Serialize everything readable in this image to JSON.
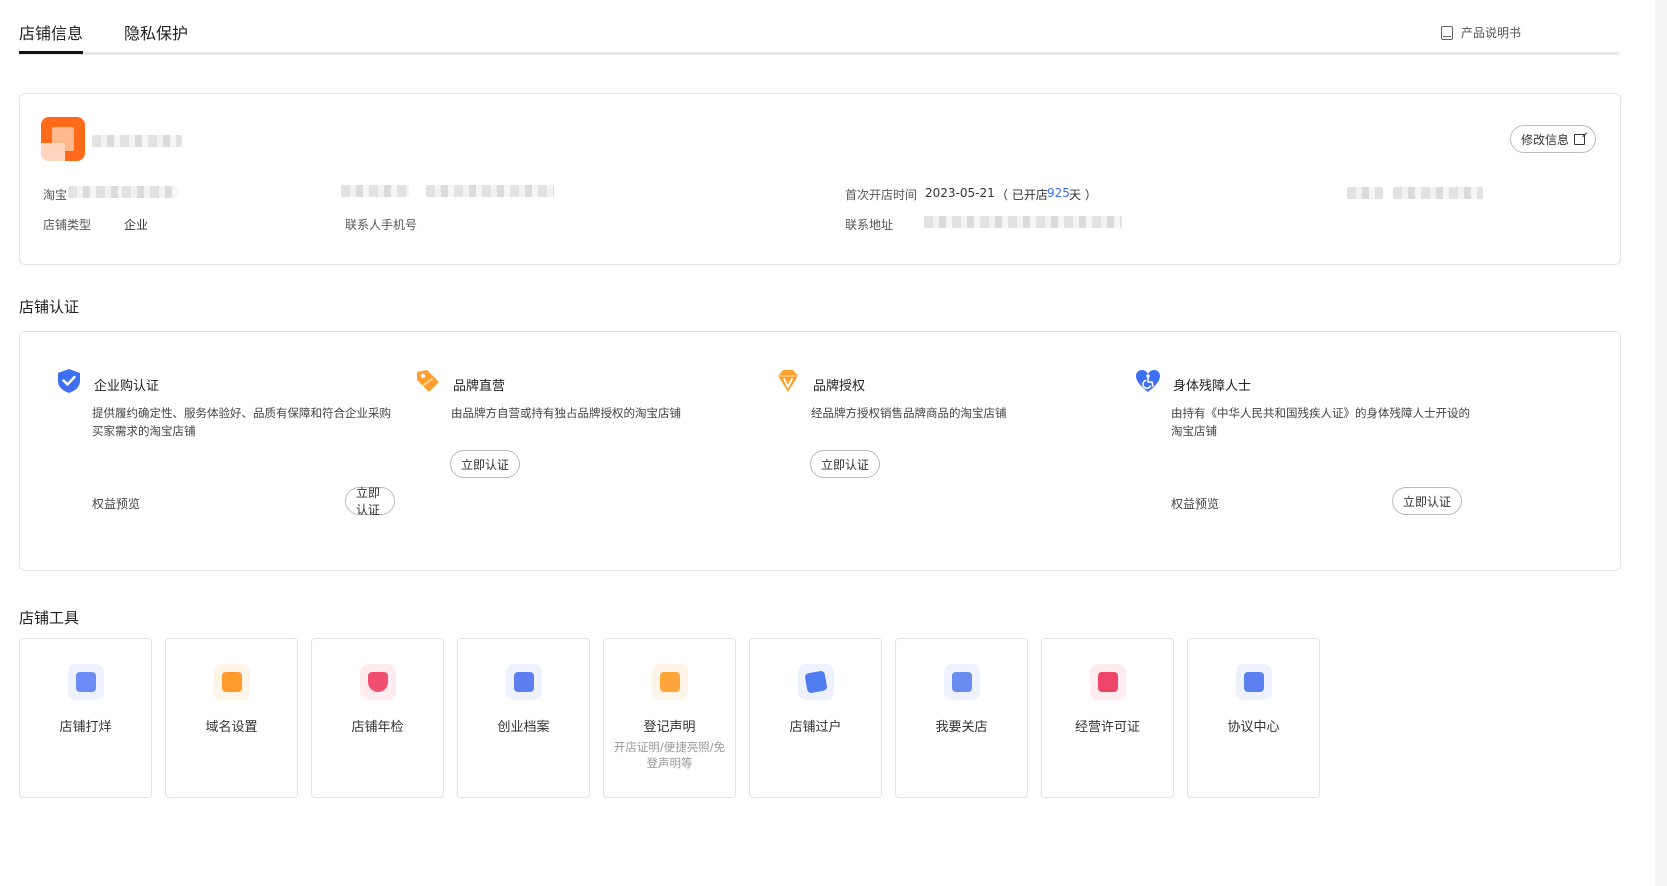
{
  "tabs": [
    {
      "label": "店铺信息",
      "active": true
    },
    {
      "label": "隐私保护",
      "active": false
    }
  ],
  "manual_link": "产品说明书",
  "store": {
    "edit_button": "修改信息",
    "label_platform": "淘宝",
    "label_type": "店铺类型",
    "type_value": "企业",
    "label_contact_phone": "联系人手机号",
    "label_first_open": "首次开店时间",
    "first_open_date": "2023-05-21",
    "open_days_prefix": "（ 已开店",
    "open_days": "925",
    "open_days_suffix": "天 ）",
    "label_address": "联系地址"
  },
  "cert_section_title": "店铺认证",
  "certs": [
    {
      "title": "企业购认证",
      "desc": "提供履约确定性、服务体验好、品质有保障和符合企业采购买家需求的淘宝店铺",
      "benefit": "权益预览",
      "button": "立即认证",
      "icon": "shield-check-icon"
    },
    {
      "title": "品牌直营",
      "desc": "由品牌方自营或持有独占品牌授权的淘宝店铺",
      "button": "立即认证",
      "icon": "tag-icon"
    },
    {
      "title": "品牌授权",
      "desc": "经品牌方授权销售品牌商品的淘宝店铺",
      "button": "立即认证",
      "icon": "diamond-icon"
    },
    {
      "title": "身体残障人士",
      "desc": "由持有《中华人民共和国残疾人证》的身体残障人士开设的淘宝店铺",
      "benefit": "权益预览",
      "button": "立即认证",
      "icon": "heart-accessibility-icon"
    }
  ],
  "tools_section_title": "店铺工具",
  "tools": [
    {
      "label": "店铺打烊",
      "sub": "",
      "icon": "store-close-icon",
      "color": "#6c8cf5",
      "bg": "#eef2ff"
    },
    {
      "label": "域名设置",
      "sub": "",
      "icon": "domain-icon",
      "color": "#ff9a2e",
      "bg": "#fff4e8"
    },
    {
      "label": "店铺年检",
      "sub": "",
      "icon": "shield-search-icon",
      "color": "#f0506e",
      "bg": "#ffecef"
    },
    {
      "label": "创业档案",
      "sub": "",
      "icon": "archive-icon",
      "color": "#5b7ff0",
      "bg": "#eef2ff"
    },
    {
      "label": "登记声明",
      "sub": "开店证明/便捷亮照/免登声明等",
      "icon": "document-icon",
      "color": "#ffa53a",
      "bg": "#fff4e8"
    },
    {
      "label": "店铺过户",
      "sub": "",
      "icon": "transfer-card-icon",
      "color": "#4f7cf0",
      "bg": "#eef2ff"
    },
    {
      "label": "我要关店",
      "sub": "",
      "icon": "close-store-icon",
      "color": "#6a8cf0",
      "bg": "#eef2ff"
    },
    {
      "label": "经营许可证",
      "sub": "",
      "icon": "license-folder-icon",
      "color": "#f0456a",
      "bg": "#ffecef"
    },
    {
      "label": "协议中心",
      "sub": "",
      "icon": "agreement-icon",
      "color": "#5b80f0",
      "bg": "#eef2ff"
    }
  ]
}
